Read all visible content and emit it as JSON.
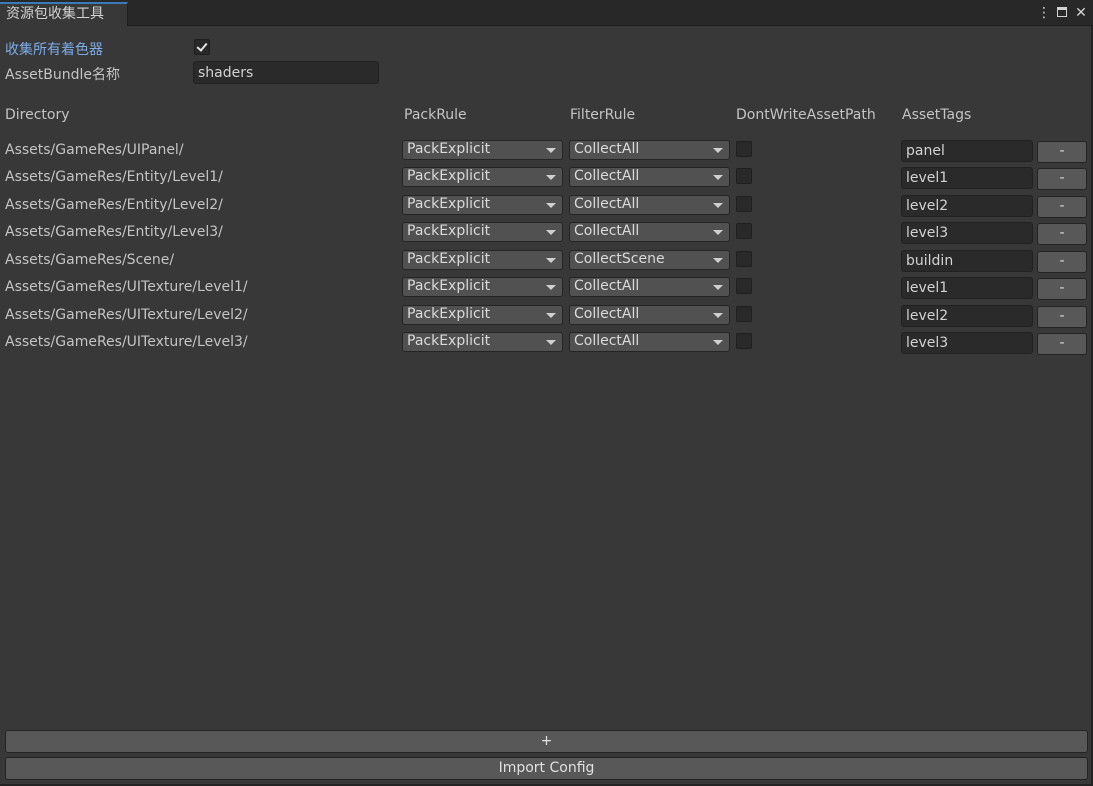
{
  "window": {
    "tab_title": "资源包收集工具",
    "menu_icon": "⋮",
    "maximize_icon": "maximize-icon",
    "close_icon": "✕"
  },
  "settings": {
    "collect_shaders_label": "收集所有着色器",
    "collect_shaders_checked": true,
    "bundle_name_label": "AssetBundle名称",
    "bundle_name_value": "shaders"
  },
  "table": {
    "headers": [
      "Directory",
      "PackRule",
      "FilterRule",
      "DontWriteAssetPath",
      "AssetTags"
    ],
    "rows": [
      {
        "directory": "Assets/GameRes/UIPanel/",
        "pack_rule": "PackExplicit",
        "filter_rule": "CollectAll",
        "dont_write": false,
        "tag": "panel",
        "remove_label": "-"
      },
      {
        "directory": "Assets/GameRes/Entity/Level1/",
        "pack_rule": "PackExplicit",
        "filter_rule": "CollectAll",
        "dont_write": false,
        "tag": "level1",
        "remove_label": "-"
      },
      {
        "directory": "Assets/GameRes/Entity/Level2/",
        "pack_rule": "PackExplicit",
        "filter_rule": "CollectAll",
        "dont_write": false,
        "tag": "level2",
        "remove_label": "-"
      },
      {
        "directory": "Assets/GameRes/Entity/Level3/",
        "pack_rule": "PackExplicit",
        "filter_rule": "CollectAll",
        "dont_write": false,
        "tag": "level3",
        "remove_label": "-"
      },
      {
        "directory": "Assets/GameRes/Scene/",
        "pack_rule": "PackExplicit",
        "filter_rule": "CollectScene",
        "dont_write": false,
        "tag": "buildin",
        "remove_label": "-"
      },
      {
        "directory": "Assets/GameRes/UITexture/Level1/",
        "pack_rule": "PackExplicit",
        "filter_rule": "CollectAll",
        "dont_write": false,
        "tag": "level1",
        "remove_label": "-"
      },
      {
        "directory": "Assets/GameRes/UITexture/Level2/",
        "pack_rule": "PackExplicit",
        "filter_rule": "CollectAll",
        "dont_write": false,
        "tag": "level2",
        "remove_label": "-"
      },
      {
        "directory": "Assets/GameRes/UITexture/Level3/",
        "pack_rule": "PackExplicit",
        "filter_rule": "CollectAll",
        "dont_write": false,
        "tag": "level3",
        "remove_label": "-"
      }
    ]
  },
  "footer": {
    "add_label": "+",
    "import_label": "Import Config"
  },
  "colors": {
    "background": "#383838",
    "tab_accent": "#3a79bb",
    "active_label": "#7cabe8"
  }
}
